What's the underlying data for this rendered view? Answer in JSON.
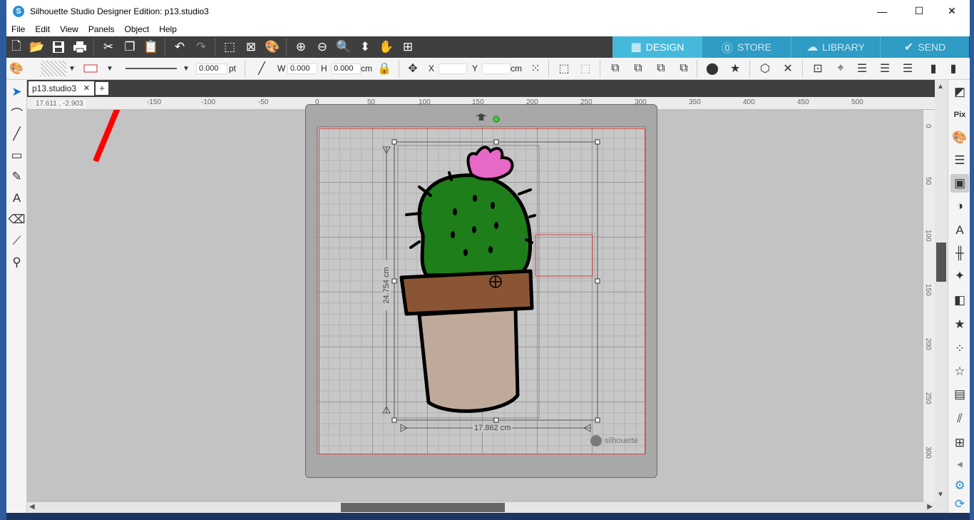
{
  "window": {
    "title": "Silhouette Studio Designer Edition: p13.studio3",
    "controls": {
      "minimize": "—",
      "maximize": "☐",
      "close": "✕"
    }
  },
  "menu": [
    "File",
    "Edit",
    "View",
    "Panels",
    "Object",
    "Help"
  ],
  "mode_tabs": [
    {
      "label": "DESIGN",
      "icon": "grid-icon",
      "active": true
    },
    {
      "label": "STORE",
      "icon": "silhouette-s-icon",
      "active": false
    },
    {
      "label": "LIBRARY",
      "icon": "cloud-icon",
      "active": false
    },
    {
      "label": "SEND",
      "icon": "check-circle-icon",
      "active": false
    }
  ],
  "properties_bar": {
    "line_weight_value": "0.000",
    "line_weight_unit": "pt",
    "w_label": "W",
    "w_value": "0.000",
    "h_label": "H",
    "h_value": "0.000",
    "size_unit": "cm",
    "x_label": "X",
    "x_value": "",
    "y_label": "Y",
    "y_value": "",
    "pos_unit": "cm"
  },
  "document_tab": {
    "name": "p13.studio3",
    "close": "✕",
    "add": "+"
  },
  "cursor_coords": "17.611 , -2.903",
  "h_ruler_ticks": [
    "-150",
    "-100",
    "-50",
    "0",
    "50",
    "100",
    "150",
    "200",
    "250",
    "300",
    "350",
    "400",
    "450",
    "500"
  ],
  "v_ruler_ticks": [
    "0",
    "50",
    "100",
    "150",
    "200",
    "250",
    "300"
  ],
  "selection": {
    "height_dim": "24.754 cm",
    "width_dim": "17.862 cm"
  },
  "mat_brand": "silhouette",
  "colors": {
    "toolbar_dark": "#3f3f3f",
    "design_tab": "#45b9dc",
    "cactus_green": "#1e7e1a",
    "flower_pink": "#e768c6",
    "pot_rim": "#8a5534",
    "pot_body": "#bfa99a",
    "annotation_arrow": "#ff0000"
  }
}
